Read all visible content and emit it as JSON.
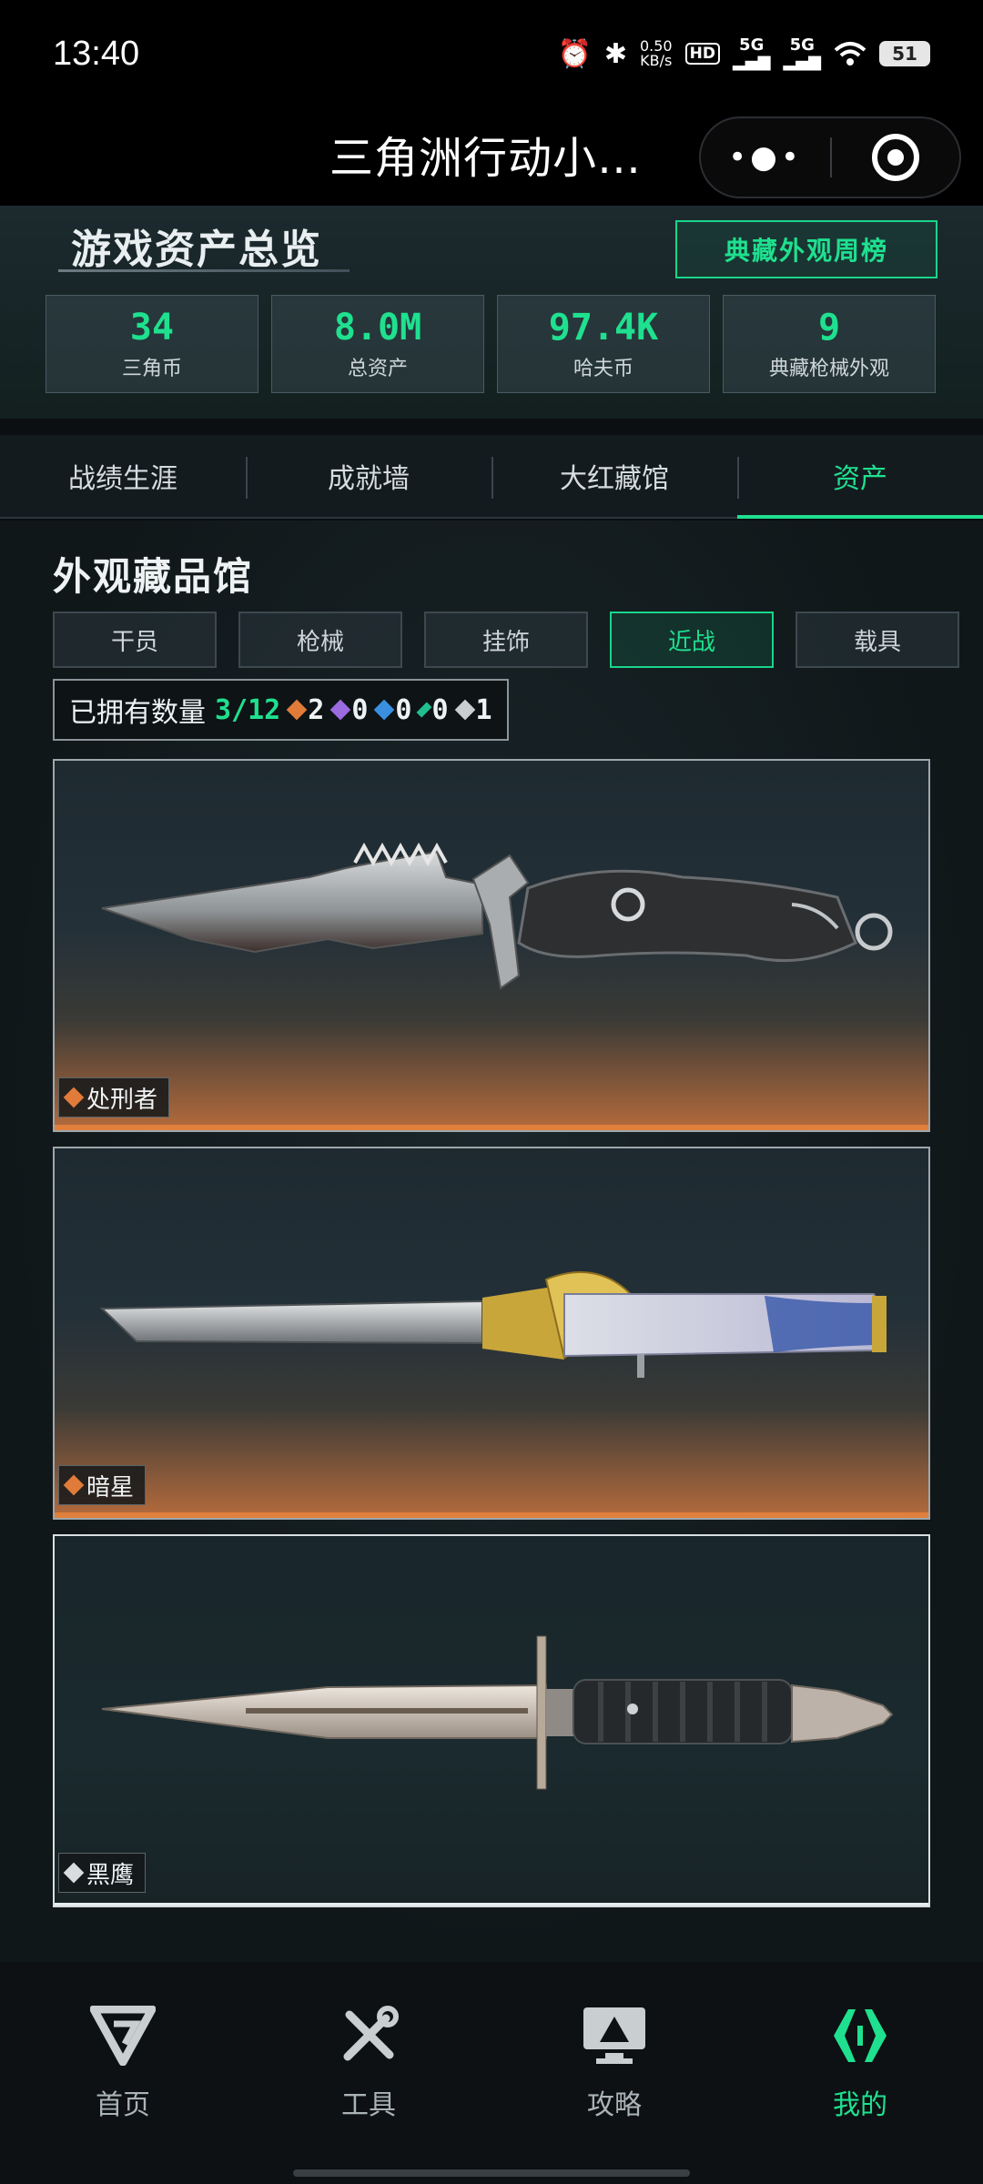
{
  "status_bar": {
    "time": "13:40",
    "net_speed": "0.50",
    "net_speed_unit": "KB/s",
    "hd": "HD",
    "signal1": "5G",
    "signal2": "5G",
    "battery": "51"
  },
  "title_bar": {
    "title": "三角洲行动小…",
    "more_icon": "more-dots-icon",
    "close_icon": "target-close-icon"
  },
  "assets": {
    "title": "游戏资产总览",
    "weekly_button": "典藏外观周榜",
    "stats": [
      {
        "value": "34",
        "label": "三角币"
      },
      {
        "value": "8.0M",
        "label": "总资产"
      },
      {
        "value": "97.4K",
        "label": "哈夫币"
      },
      {
        "value": "9",
        "label": "典藏枪械外观"
      }
    ]
  },
  "tabs": [
    {
      "label": "战绩生涯",
      "active": false
    },
    {
      "label": "成就墙",
      "active": false
    },
    {
      "label": "大红藏馆",
      "active": false
    },
    {
      "label": "资产",
      "active": true
    }
  ],
  "collection": {
    "title": "外观藏品馆",
    "filters": [
      {
        "label": "干员",
        "active": false
      },
      {
        "label": "枪械",
        "active": false
      },
      {
        "label": "挂饰",
        "active": false
      },
      {
        "label": "近战",
        "active": true
      },
      {
        "label": "载具",
        "active": false
      }
    ],
    "owned_label": "已拥有数量",
    "owned_count": "3/12",
    "rarity_counts": [
      {
        "count": "2",
        "color": "#e07b39"
      },
      {
        "count": "0",
        "color": "#9b6be0"
      },
      {
        "count": "0",
        "color": "#3a8fe0"
      },
      {
        "count": "0",
        "color": "#1fbf8f"
      },
      {
        "count": "1",
        "color": "#c9ced1"
      }
    ],
    "items": [
      {
        "name": "处刑者",
        "rarity_color": "#e07b39"
      },
      {
        "name": "暗星",
        "rarity_color": "#e07b39"
      },
      {
        "name": "黑鹰",
        "rarity_color": "#d9dde0"
      }
    ]
  },
  "bottom_nav": [
    {
      "label": "首页",
      "icon": "home-g-icon",
      "active": false
    },
    {
      "label": "工具",
      "icon": "tools-icon",
      "active": false
    },
    {
      "label": "攻略",
      "icon": "guide-monitor-icon",
      "active": false
    },
    {
      "label": "我的",
      "icon": "profile-logo-icon",
      "active": true
    }
  ],
  "colors": {
    "accent": "#1fe08f",
    "background": "#0b0f12",
    "orange_rarity": "#e07b39"
  }
}
